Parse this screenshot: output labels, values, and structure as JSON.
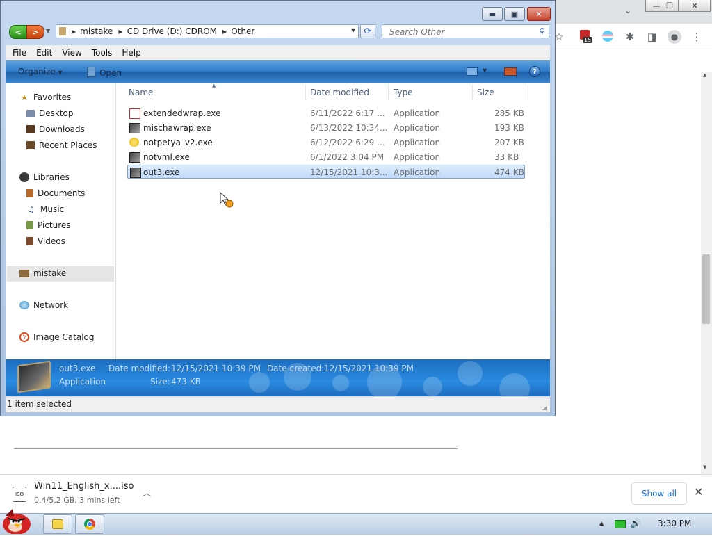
{
  "explorer": {
    "nav_back_glyph": "<",
    "nav_forward_glyph": ">",
    "breadcrumbs": [
      "mistake",
      "CD Drive (D:) CDROM",
      "Other"
    ],
    "search_placeholder": "Search Other",
    "menu": [
      "File",
      "Edit",
      "View",
      "Tools",
      "Help"
    ],
    "commandbar": {
      "organize": "Organize",
      "open": "Open"
    },
    "nav_pane": {
      "favorites": {
        "label": "Favorites",
        "items": [
          "Desktop",
          "Downloads",
          "Recent Places"
        ]
      },
      "libraries": {
        "label": "Libraries",
        "items": [
          "Documents",
          "Music",
          "Pictures",
          "Videos"
        ]
      },
      "homegroup": "mistake",
      "network": "Network",
      "image_catalog": "Image Catalog"
    },
    "columns": {
      "name": "Name",
      "date": "Date modified",
      "type": "Type",
      "size": "Size"
    },
    "files": [
      {
        "name": "extendedwrap.exe",
        "date": "6/11/2022 6:17 ...",
        "type": "Application",
        "size": "285 KB",
        "icon": "pdf-doc-icon"
      },
      {
        "name": "mischawrap.exe",
        "date": "6/13/2022 10:34...",
        "type": "Application",
        "size": "193 KB",
        "icon": "app-window-icon"
      },
      {
        "name": "notpetya_v2.exe",
        "date": "6/12/2022 6:29 ...",
        "type": "Application",
        "size": "207 KB",
        "icon": "yellow-circle-icon"
      },
      {
        "name": "notvml.exe",
        "date": "6/1/2022 3:04 PM",
        "type": "Application",
        "size": "33 KB",
        "icon": "app-window-icon"
      },
      {
        "name": "out3.exe",
        "date": "12/15/2021 10:3...",
        "type": "Application",
        "size": "474 KB",
        "icon": "app-window-icon",
        "selected": true
      }
    ],
    "details": {
      "name": "out3.exe",
      "type": "Application",
      "modified_label": "Date modified:",
      "modified_value": "12/15/2021 10:39 PM",
      "created_label": "Date created:",
      "created_value": "12/15/2021 10:39 PM",
      "size_label": "Size:",
      "size_value": "473 KB"
    },
    "status": "1 item selected"
  },
  "chrome": {
    "badge_count": "15"
  },
  "download": {
    "icon_text": "ISO",
    "filename": "Win11_English_x....iso",
    "status": "0.4/5.2 GB, 3 mins left",
    "show_all": "Show all"
  },
  "taskbar": {
    "clock": "3:30 PM"
  },
  "colors": {
    "aero_blue": "#2d78c6",
    "selection": "#c1dbfc",
    "chrome_link": "#1a73e8"
  }
}
